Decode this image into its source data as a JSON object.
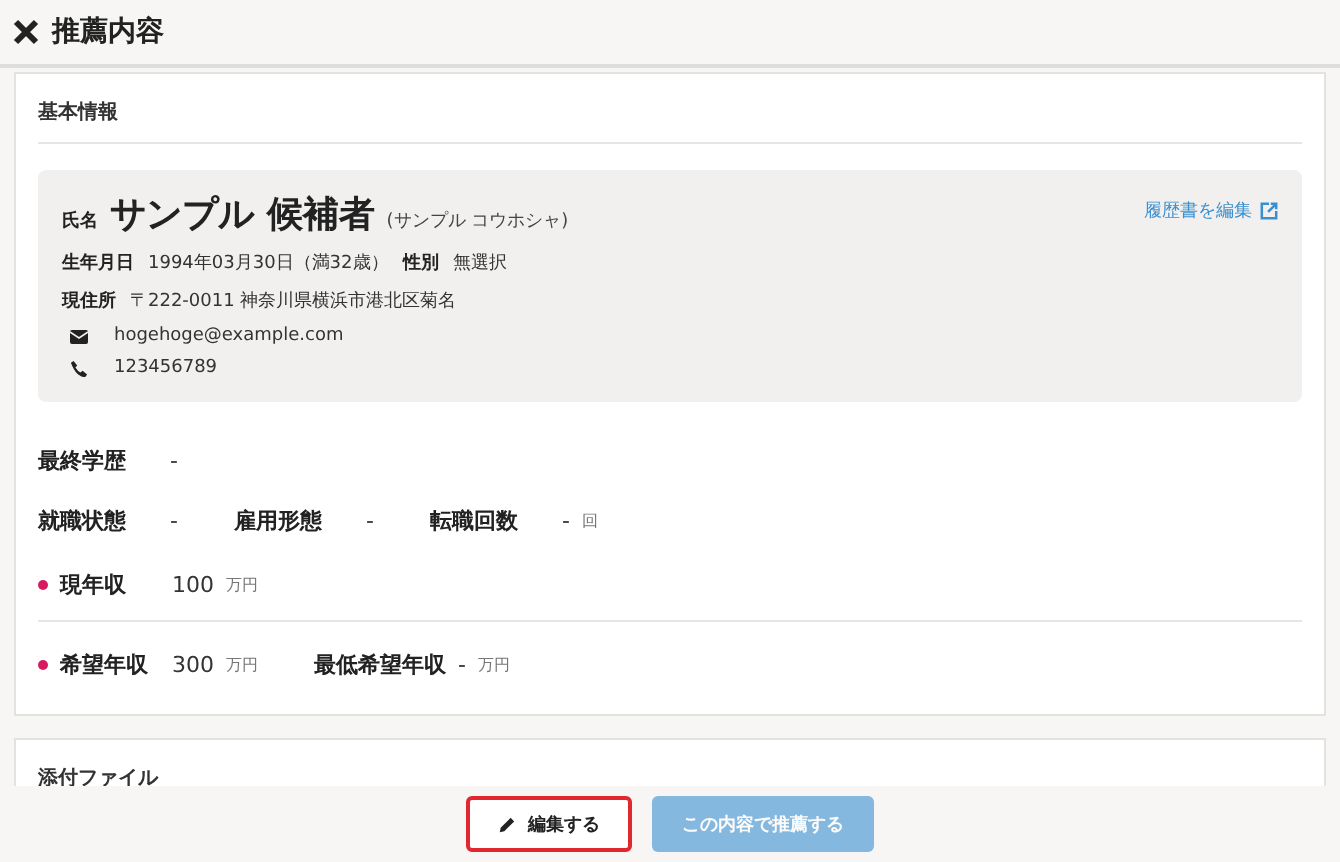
{
  "header": {
    "title": "推薦内容"
  },
  "basic": {
    "title": "基本情報",
    "profile": {
      "name_label": "氏名",
      "name": "サンプル 候補者",
      "kana": "(サンプル コウホシャ)",
      "edit_link": "履歴書を編集",
      "birth_label": "生年月日",
      "birth": "1994年03月30日（満32歳）",
      "gender_label": "性別",
      "gender": "無選択",
      "address_label": "現住所",
      "address": "〒222-0011  神奈川県横浜市港北区菊名",
      "email": "hogehoge@example.com",
      "phone": "123456789"
    },
    "rows": [
      {
        "fields": [
          {
            "label": "最終学歴",
            "value": "-",
            "required": false
          }
        ]
      },
      {
        "fields": [
          {
            "label": "就職状態",
            "value": "-",
            "required": false
          },
          {
            "label": "雇用形態",
            "value": "-",
            "required": false
          },
          {
            "label": "転職回数",
            "value": "-",
            "unit": "回",
            "required": false
          }
        ]
      },
      {
        "fields": [
          {
            "label": "現年収",
            "value": "100",
            "unit": "万円",
            "required": true
          }
        ],
        "divider_after": true
      },
      {
        "fields": [
          {
            "label": "希望年収",
            "value": "300",
            "unit": "万円",
            "required": true
          },
          {
            "label": "最低希望年収",
            "value": "-",
            "unit": "万円",
            "required": false
          }
        ]
      }
    ]
  },
  "attachments": {
    "title": "添付ファイル"
  },
  "footer": {
    "buttons": [
      {
        "label": "編集する",
        "kind": "edit",
        "highlighted": true,
        "disabled": false
      },
      {
        "label": "この内容で推薦する",
        "kind": "primary",
        "highlighted": false,
        "disabled": true
      }
    ]
  }
}
